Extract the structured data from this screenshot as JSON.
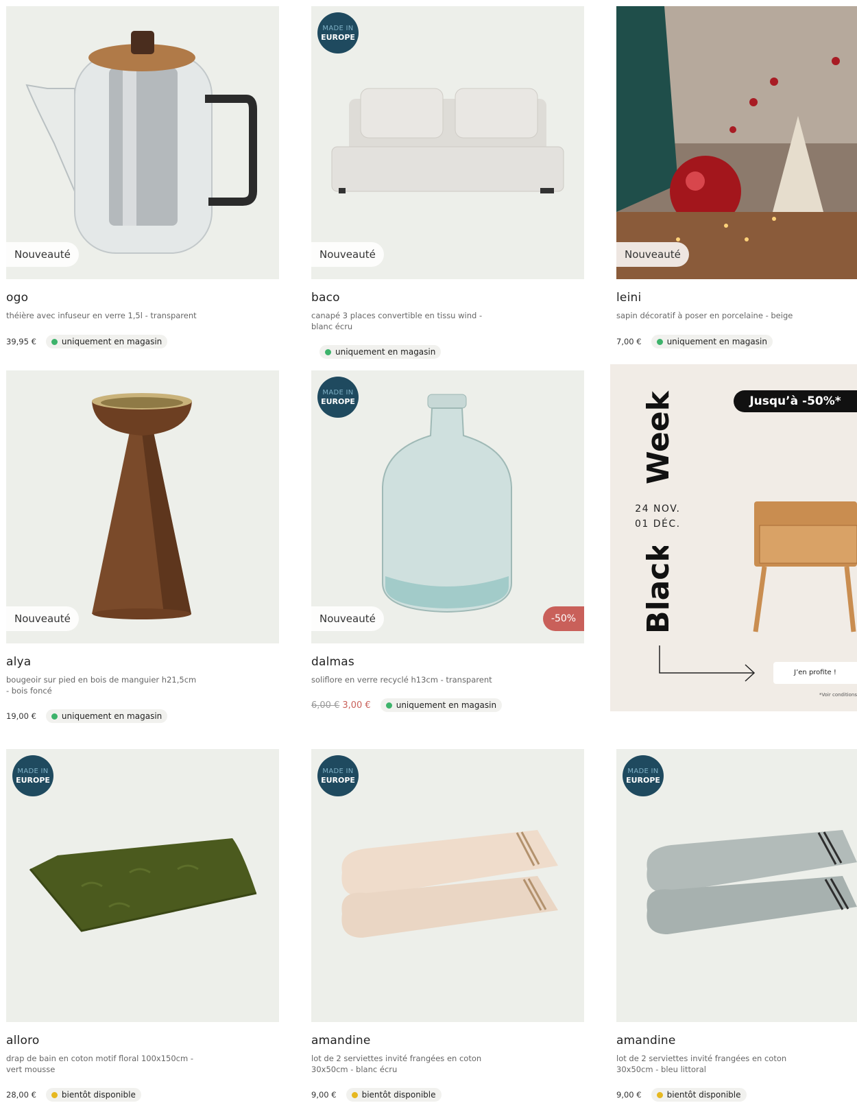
{
  "colors": {
    "card_bg": "#edefea",
    "europe_badge": "#1f4a5f",
    "discount_badge": "#c9605a",
    "dot_instore": "#3db36b",
    "dot_soon": "#e6b820"
  },
  "badges": {
    "new": "Nouveauté",
    "europe_line1": "MADE IN",
    "europe_line2": "EUROPE"
  },
  "products": [
    {
      "name": "ogo",
      "desc": "théière avec infuseur en verre 1,5l - transparent",
      "price": "39,95 €",
      "availability": "uniquement en magasin"
    },
    {
      "name": "baco",
      "desc": "canapé 3 places convertible en tissu wind - blanc écru",
      "availability": "uniquement en magasin"
    },
    {
      "name": "leini",
      "desc": "sapin décoratif à poser en porcelaine - beige",
      "price": "7,00 €",
      "availability": "uniquement en magasin"
    },
    {
      "name": "alya",
      "desc": "bougeoir sur pied en bois de manguier h21,5cm - bois foncé",
      "price": "19,00 €",
      "availability": "uniquement en magasin"
    },
    {
      "name": "dalmas",
      "desc": "soliflore en verre recyclé h13cm - transparent",
      "old_price": "6,00 €",
      "sale_price": "3,00 €",
      "discount": "-50%",
      "availability": "uniquement en magasin"
    },
    {
      "name": "alloro",
      "desc": "drap de bain en coton motif floral 100x150cm - vert mousse",
      "price": "28,00 €",
      "availability": "bientôt disponible"
    },
    {
      "name": "amandine",
      "desc": "lot de 2 serviettes invité frangées en coton 30x50cm - blanc écru",
      "price": "9,00 €",
      "availability": "bientôt disponible"
    },
    {
      "name": "amandine",
      "desc": "lot de 2 serviettes invité frangées en coton 30x50cm - bleu littoral",
      "price": "9,00 €",
      "availability": "bientôt disponible"
    }
  ],
  "banner": {
    "word1": "Black",
    "word2": "Week",
    "date1": "24 NOV.",
    "date2": "01 DÉC.",
    "promo": "Jusqu’à -50%*",
    "cta": "J’en profite !",
    "note": "*Voir conditions"
  }
}
